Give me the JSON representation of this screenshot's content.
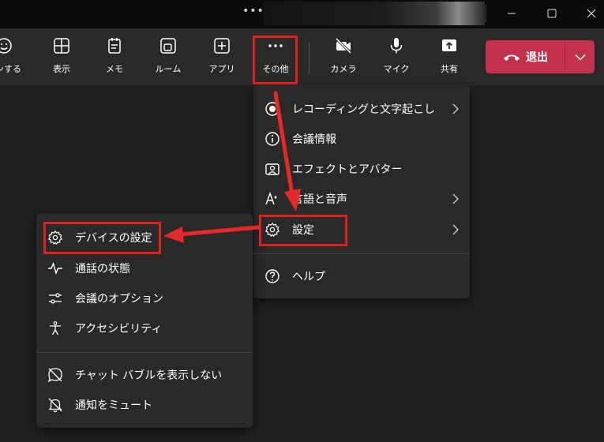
{
  "toolbar": {
    "items": [
      {
        "label": "ョンする",
        "icon": "emoji-icon"
      },
      {
        "label": "表示",
        "icon": "grid-icon"
      },
      {
        "label": "メモ",
        "icon": "notes-icon"
      },
      {
        "label": "ルーム",
        "icon": "rooms-icon"
      },
      {
        "label": "アプリ",
        "icon": "plus-icon"
      },
      {
        "label": "その他",
        "icon": "more-icon"
      },
      {
        "label": "カメラ",
        "icon": "camera-off-icon"
      },
      {
        "label": "マイク",
        "icon": "mic-icon"
      },
      {
        "label": "共有",
        "icon": "share-icon"
      }
    ],
    "leave_label": "退出"
  },
  "more_menu": {
    "items": [
      {
        "label": "レコーディングと文字起こし",
        "icon": "record-icon",
        "submenu": true
      },
      {
        "label": "会議情報",
        "icon": "info-icon",
        "submenu": false
      },
      {
        "label": "エフェクトとアバター",
        "icon": "effects-icon",
        "submenu": false
      },
      {
        "label": "言語と音声",
        "icon": "language-icon",
        "submenu": true
      },
      {
        "label": "設定",
        "icon": "gear-icon",
        "submenu": true
      },
      {
        "label": "ヘルプ",
        "icon": "help-icon",
        "submenu": false
      }
    ]
  },
  "settings_menu": {
    "items": [
      {
        "label": "デバイスの設定",
        "icon": "gear-icon"
      },
      {
        "label": "通話の状態",
        "icon": "activity-icon"
      },
      {
        "label": "会議のオプション",
        "icon": "sliders-icon"
      },
      {
        "label": "アクセシビリティ",
        "icon": "accessibility-icon"
      },
      {
        "label": "チャット バブルを表示しない",
        "icon": "chat-bubble-off-icon"
      },
      {
        "label": "通知をミュート",
        "icon": "bell-off-icon"
      }
    ]
  },
  "colors": {
    "leave": "#c4314b",
    "highlight": "#e02020",
    "panel": "#292929",
    "background": "#1f1f1f"
  }
}
